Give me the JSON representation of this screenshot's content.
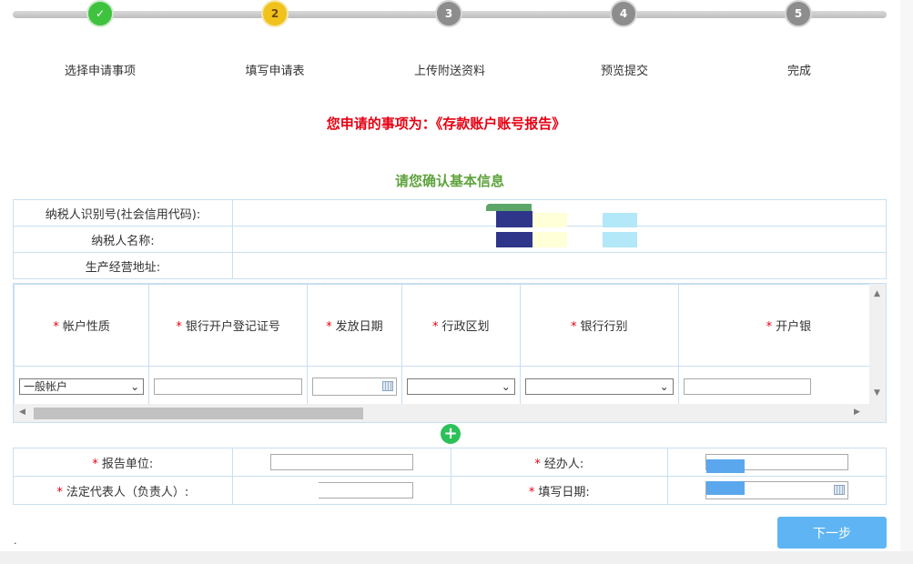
{
  "colors": {
    "done": "#3fc33f",
    "current": "#f1c21c",
    "pending": "#8d8d8d",
    "title_red": "#e60012",
    "subtitle_green": "#5fa33e",
    "primary_button": "#5fb5f3",
    "add_green": "#2cc158"
  },
  "stepper": [
    {
      "number": "✓",
      "label": "选择申请事项",
      "status": "done",
      "icon": "check-icon"
    },
    {
      "number": "2",
      "label": "填写申请表",
      "status": "current"
    },
    {
      "number": "3",
      "label": "上传附送资料",
      "status": "pending"
    },
    {
      "number": "4",
      "label": "预览提交",
      "status": "pending"
    },
    {
      "number": "5",
      "label": "完成",
      "status": "pending"
    }
  ],
  "application_title": "您申请的事项为：《存款账户账号报告》",
  "section_title": "请您确认基本信息",
  "basic_info": {
    "taxpayer_id_label": "纳税人识别号(社会信用代码):",
    "taxpayer_name_label": "纳税人名称:",
    "address_label": "生产经营地址:"
  },
  "grid": {
    "required_mark": "*",
    "columns": [
      "帐户性质",
      "银行开户登记证号",
      "发放日期",
      "行政区划",
      "银行行别",
      "开户银"
    ],
    "row": {
      "account_type": "一般帐户"
    }
  },
  "footer_form": {
    "report_unit_label": "报告单位:",
    "handler_label": "经办人:",
    "legal_rep_label": "法定代表人（负责人）:",
    "fill_date_label": "填写日期:"
  },
  "next_button": "下一步",
  "dot": "."
}
